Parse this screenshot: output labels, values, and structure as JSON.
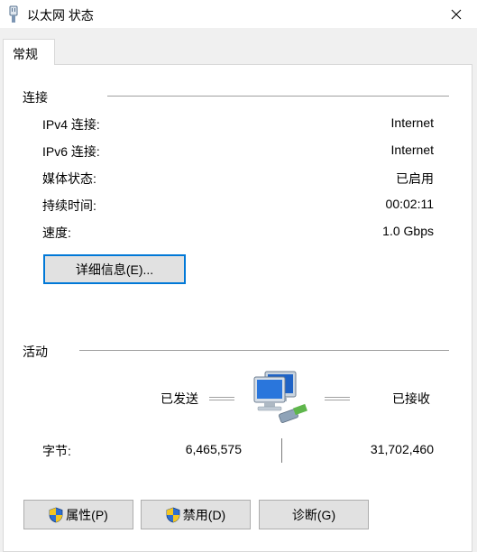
{
  "window": {
    "title": "以太网 状态",
    "icon": "ethernet-adapter-icon",
    "close_icon": "close-icon"
  },
  "tabs": [
    {
      "label": "常规"
    }
  ],
  "connection": {
    "heading": "连接",
    "rows": [
      {
        "label": "IPv4 连接:",
        "value": "Internet"
      },
      {
        "label": "IPv6 连接:",
        "value": "Internet"
      },
      {
        "label": "媒体状态:",
        "value": "已启用"
      },
      {
        "label": "持续时间:",
        "value": "00:02:11"
      },
      {
        "label": "速度:",
        "value": "1.0 Gbps"
      }
    ],
    "details_button": "详细信息(E)..."
  },
  "activity": {
    "heading": "活动",
    "sent_label": "已发送",
    "received_label": "已接收",
    "network_icon": "network-computers-icon",
    "bytes_label": "字节:",
    "bytes_sent": "6,465,575",
    "bytes_received": "31,702,460"
  },
  "buttons": {
    "properties": "属性(P)",
    "disable": "禁用(D)",
    "diagnose": "诊断(G)",
    "shield_icon": "uac-shield-icon"
  },
  "colors": {
    "focus_border": "#0078d7",
    "button_face": "#e1e1e1",
    "window_bg": "#f0f0f0"
  }
}
